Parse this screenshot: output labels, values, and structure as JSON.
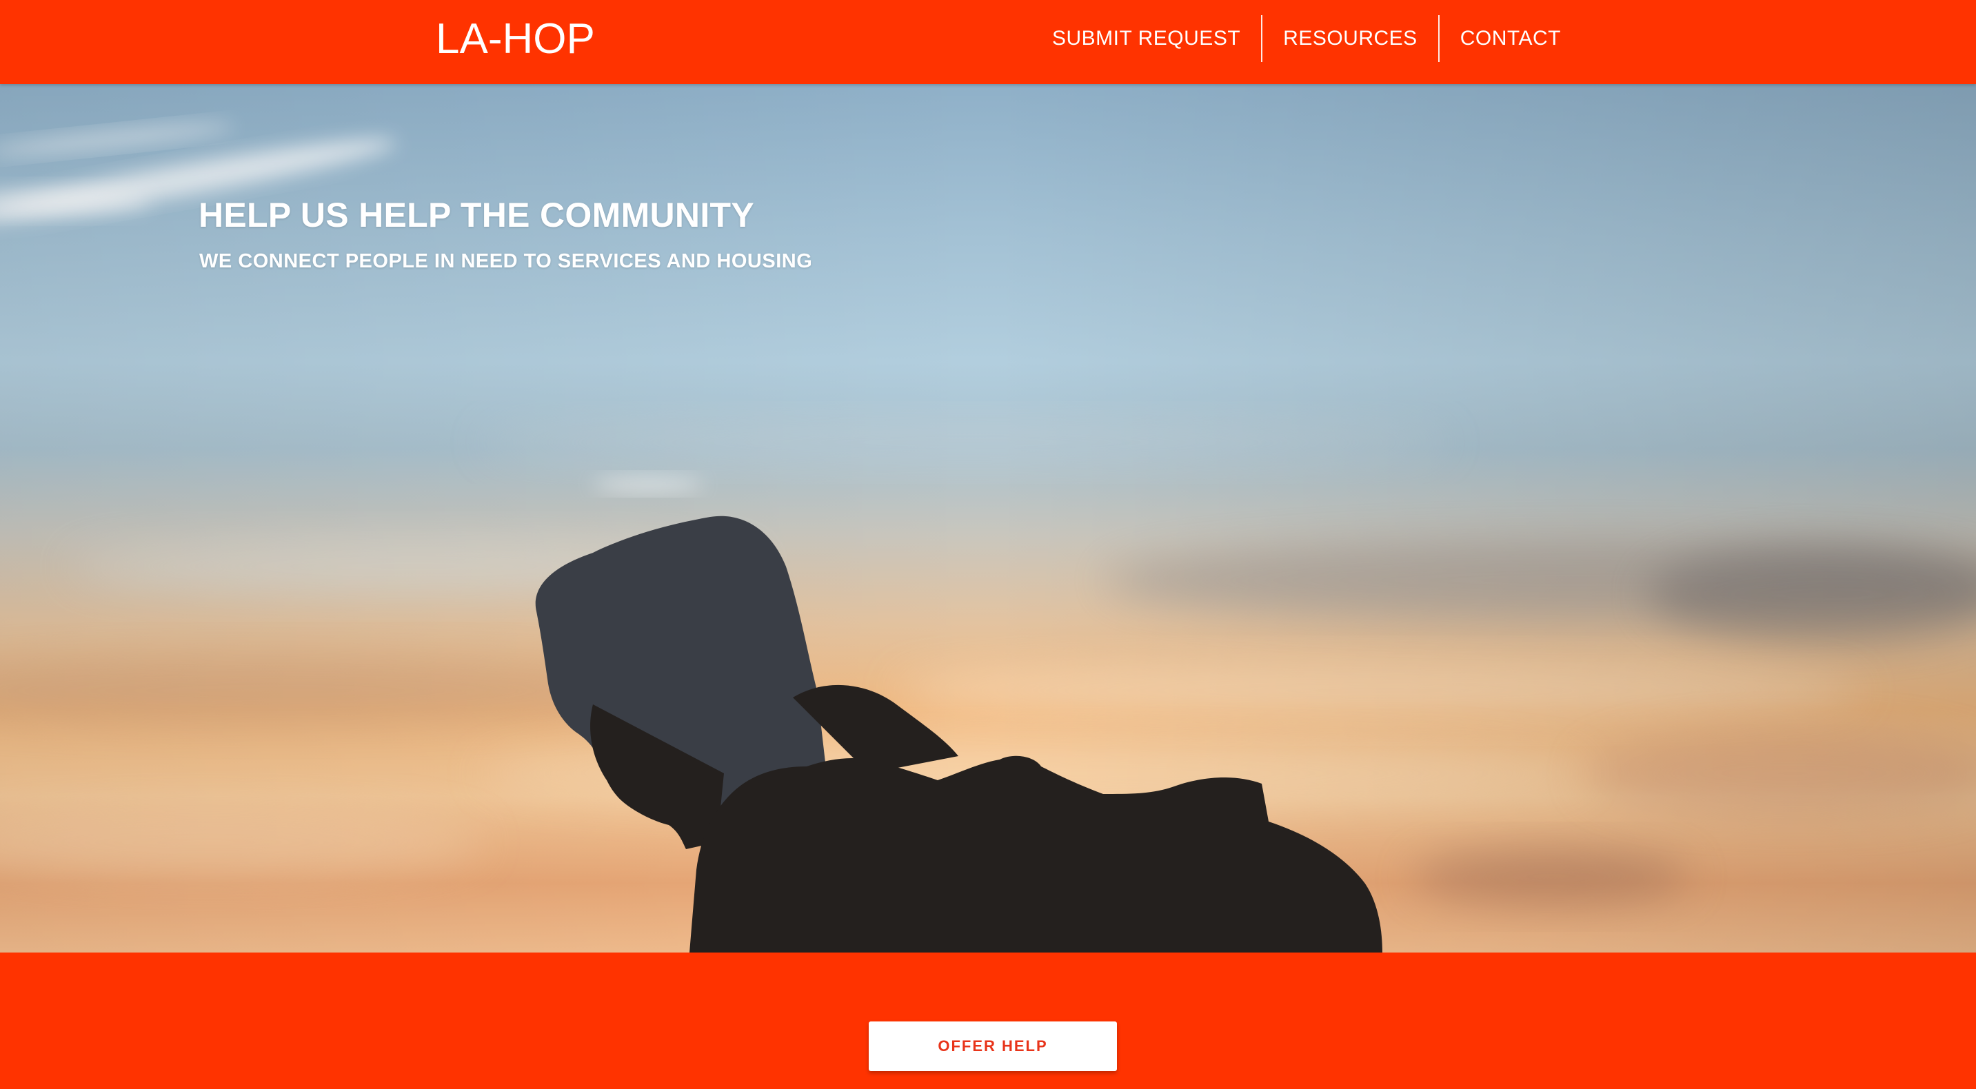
{
  "header": {
    "logo": "LA-HOP",
    "nav": [
      {
        "label": "SUBMIT REQUEST"
      },
      {
        "label": "RESOURCES"
      },
      {
        "label": "CONTACT"
      }
    ]
  },
  "hero": {
    "title": "HELP US HELP THE COMMUNITY",
    "subtitle": "WE CONNECT PEOPLE IN NEED TO SERVICES AND HOUSING",
    "image": "silhouette-of-hooded-person-against-sunset-sky"
  },
  "cta": {
    "label": "OFFER HELP"
  },
  "colors": {
    "brand": "#ff3300",
    "button_bg": "#ffffff",
    "button_text": "#e8341a"
  }
}
